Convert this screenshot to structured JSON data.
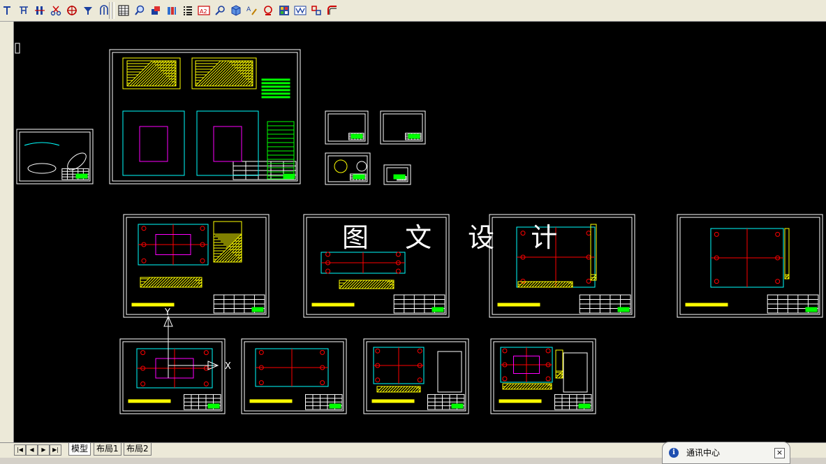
{
  "toolbar": {
    "left_icons": [
      "distance-tool-icon",
      "dimension-linear-icon",
      "dimension-stack-icon",
      "scissors-tool-icon",
      "target-crosshair-icon",
      "filter-funnel-icon",
      "fork-tool-icon"
    ],
    "right_icons": [
      "grid-table-icon",
      "zoom-magnifier-icon",
      "layer-color-icon",
      "block-icon",
      "list-icon",
      "a2-text-icon",
      "search-icon",
      "cube-3d-icon",
      "attribute-edit-icon",
      "properties-icon",
      "palette-icon",
      "text-style-icon",
      "layout-icon",
      "corner-icon"
    ]
  },
  "canvas": {
    "background": "#000000",
    "watermark": "图 文 设 计",
    "ucs_labels": {
      "y": "Y",
      "x": "X"
    }
  },
  "tabs": {
    "nav_buttons": [
      "first-tab-button",
      "prev-tab-button",
      "next-tab-button",
      "last-tab-button"
    ],
    "items": [
      {
        "label": "模型",
        "active": true
      },
      {
        "label": "布局1",
        "active": false
      },
      {
        "label": "布局2",
        "active": false
      }
    ]
  },
  "comm_center": {
    "title": "通讯中心",
    "close": "×",
    "info_icon": "i"
  },
  "colors": {
    "sheet_border": "#ffffff",
    "hatch": "#ffff00",
    "geometry_green": "#00ff00",
    "geometry_cyan": "#00ffff",
    "geometry_red": "#ff0000",
    "geometry_magenta": "#ff00ff"
  }
}
